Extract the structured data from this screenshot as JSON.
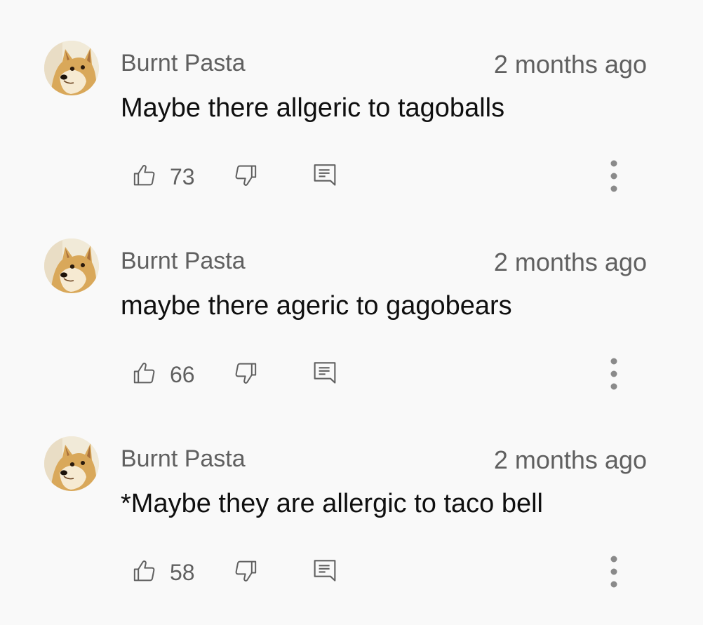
{
  "comments": [
    {
      "author": "Burnt Pasta",
      "time": "2 months ago",
      "text": "Maybe there allgeric to tagoballs",
      "likes": "73"
    },
    {
      "author": "Burnt Pasta",
      "time": "2 months ago",
      "text": "maybe there ageric to gagobears",
      "likes": "66"
    },
    {
      "author": "Burnt Pasta",
      "time": "2 months ago",
      "text": "*Maybe they are allergic to taco bell",
      "likes": "58"
    }
  ],
  "icons": {
    "like": "thumbs-up-icon",
    "dislike": "thumbs-down-icon",
    "reply": "reply-comment-icon",
    "more": "more-vertical-icon"
  },
  "colors": {
    "background": "#f9f9f9",
    "secondary_text": "#606060",
    "primary_text": "#0f0f0f"
  }
}
